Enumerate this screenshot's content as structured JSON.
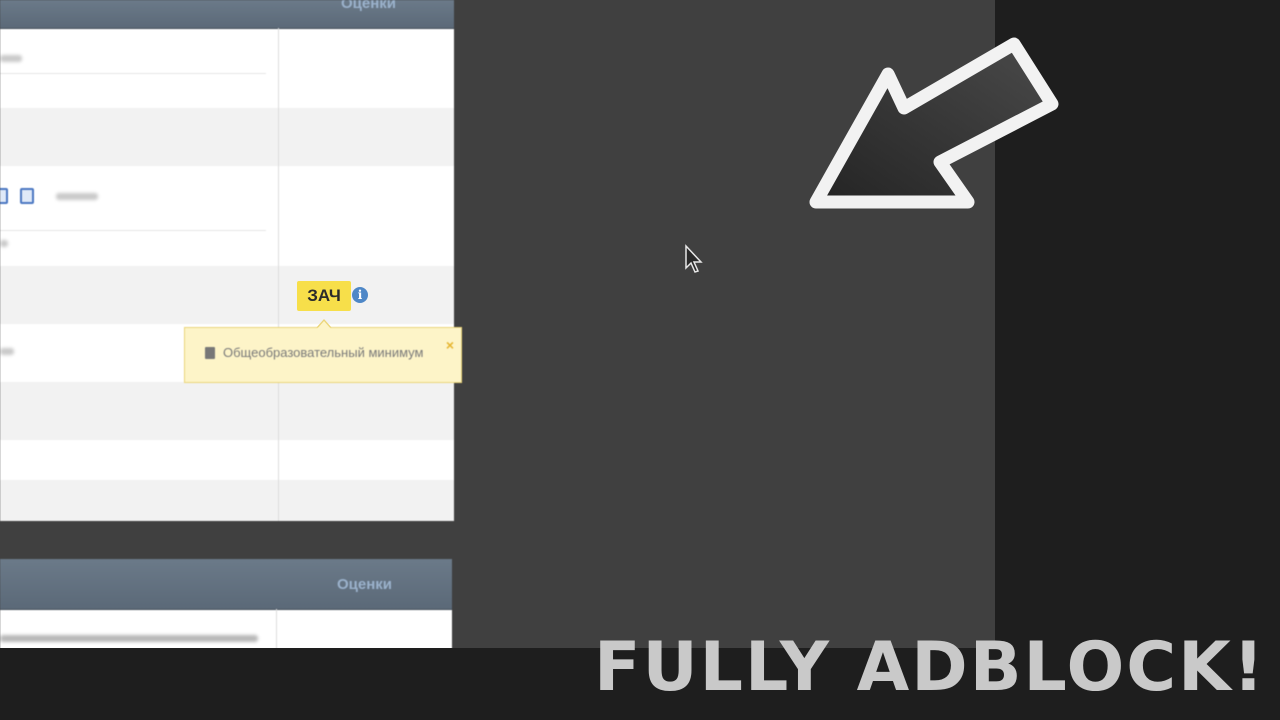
{
  "table": {
    "column_header": "Оценки",
    "grade_badge": "ЗАЧ",
    "info_icon": "i",
    "tooltip_text": "Общеобразовательный минимум",
    "tooltip_close": "×"
  },
  "table2": {
    "column_header": "Оценки"
  },
  "headline": "FULLY ADBLOCK!",
  "colors": {
    "panel": "#404040",
    "background": "#1e1e1e",
    "badge": "#f7df4a",
    "tooltip": "#fdf4c8",
    "header": "#5b6978",
    "headline": "#c9c9c9"
  },
  "icons": [
    "doc-icon",
    "info-icon",
    "book-icon",
    "close-icon",
    "mouse-cursor-icon",
    "pointer-arrow-icon"
  ]
}
